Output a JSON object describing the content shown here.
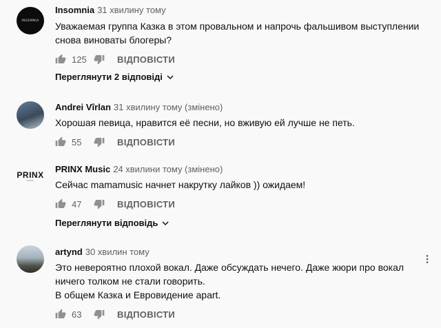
{
  "comments": [
    {
      "author": "Insomnia",
      "time": "31 хвилину тому",
      "avatar_text": "INSOMNIA",
      "lines": [
        "Уважаемая группа Казка в этом провальном и напрочь фальшивом выступлении",
        "снова виноваты блогеры?"
      ],
      "likes": "125",
      "reply_label": "ВІДПОВІСТИ",
      "view_replies": "Переглянути 2 відповіді"
    },
    {
      "author": "Andrei Vîrlan",
      "time": "31 хвилину тому (змінено)",
      "lines": [
        "Хорошая певица, нравится её песни, но вживую ей лучше не петь."
      ],
      "likes": "55",
      "reply_label": "ВІДПОВІСТИ"
    },
    {
      "author": "PRINX Music",
      "time": "24 хвилини тому (змінено)",
      "avatar_logo": "PRINX",
      "avatar_logo_sub": "MUSIC",
      "lines": [
        "Сейчас mamamusic начнет накрутку лайков )) ожидаем!"
      ],
      "likes": "47",
      "reply_label": "ВІДПОВІСТИ",
      "view_replies": "Переглянути відповідь"
    },
    {
      "author": "artynd",
      "time": "30 хвилин тому",
      "lines": [
        "Это невероятно плохой вокал. Даже обсуждать нечего. Даже жюри про вокал",
        "ничего толком не стали говорить.",
        "В общем Казка и Евровидение apart."
      ],
      "likes": "63",
      "reply_label": "ВІДПОВІСТИ"
    }
  ],
  "icons": {
    "like": "thumb-up-icon",
    "dislike": "thumb-down-icon",
    "expand": "chevron-down-icon",
    "menu": "more-vert-icon"
  }
}
